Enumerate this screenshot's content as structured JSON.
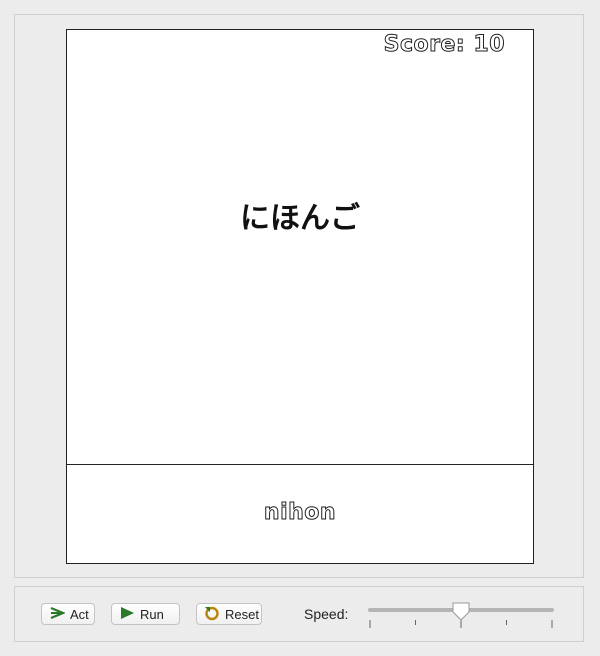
{
  "game": {
    "score_text": "Score: 10",
    "kana": "にほんご",
    "romaji": "nihon"
  },
  "controls": {
    "act_label": "Act",
    "run_label": "Run",
    "reset_label": "Reset",
    "speed_label": "Speed:",
    "speed_value_fraction": 0.5
  },
  "colors": {
    "background": "#ececec",
    "world": "#ffffff",
    "play_green": "#2a7a2a"
  },
  "icons": {
    "act": "step-arrow-icon",
    "run": "play-icon",
    "reset": "reset-icon"
  }
}
